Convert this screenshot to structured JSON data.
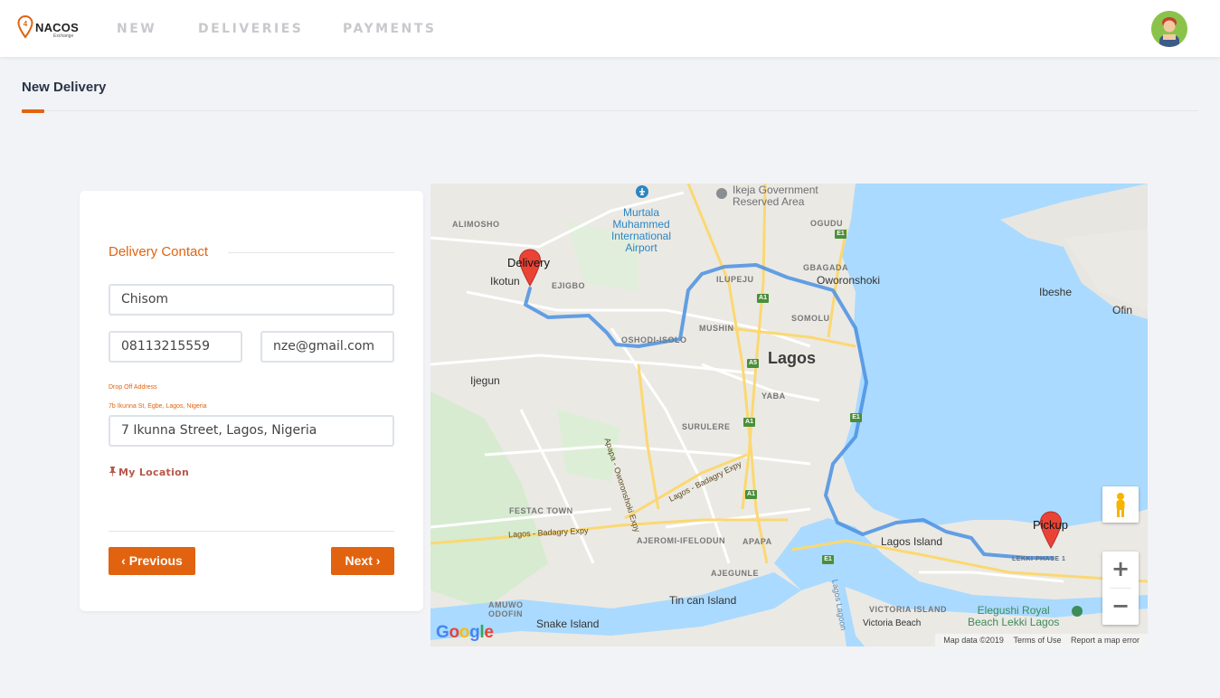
{
  "header": {
    "logo_text": "NACOS",
    "logo_sub": "Exchange",
    "nav": [
      "NEW",
      "DELIVERIES",
      "PAYMENTS"
    ]
  },
  "page": {
    "title": "New Delivery"
  },
  "form": {
    "section_title": "Delivery Contact",
    "name_value": "Chisom",
    "phone_value": "08113215559",
    "email_value": "nze@gmail.com",
    "dropoff_label": "Drop Off Address",
    "dropoff_hint": "7b Ikunna St, Egbe, Lagos, Nigeria",
    "address_value": "7 Ikunna Street, Lagos, Nigeria",
    "my_location": "My Location",
    "prev_label": "Previous",
    "next_label": "Next"
  },
  "map": {
    "markers": {
      "delivery": "Delivery",
      "pickup": "Pickup"
    },
    "labels": {
      "alimosho": "ALIMOSHO",
      "ikotun": "Ikotun",
      "ejigbo": "EJIGBO",
      "ijegun": "Ijegun",
      "airport": [
        "Murtala",
        "Muhammed",
        "International",
        "Airport"
      ],
      "reserved": [
        "Ikeja Government",
        "Reserved Area"
      ],
      "ogudu": "OGUDU",
      "gbagada": "GBAGADA",
      "oworonshoki": "Oworonshoki",
      "ilupeju": "ILUPEJU",
      "mushin": "MUSHIN",
      "somolu": "SOMOLU",
      "oshodi": "OSHODI-ISOLO",
      "lagos": "Lagos",
      "yaba": "YABA",
      "surulere": "SURULERE",
      "apapa_oworonshoki": "Apapa - Oworonshoki Expy",
      "lagos_badagry": "Lagos - Badagry Expy",
      "lagos_badagry_2": "Lagos - Badagry Expy",
      "festac": "FESTAC TOWN",
      "ajeromi": "AJEROMI-IFELODUN",
      "apapa": "APAPA",
      "ajegunle": "AJEGUNLE",
      "tincan": "Tin can Island",
      "amuwo": [
        "AMUWO",
        "ODOFIN"
      ],
      "snake": "Snake Island",
      "lagos_island": "Lagos Island",
      "victoria_island": "VICTORIA ISLAND",
      "victoria_beach": "Victoria Beach",
      "lagos_lagoon": "Lagos Lagoon",
      "lekki": "LEKKI PHASE 1",
      "elegushi": [
        "Elegushi Royal",
        "Beach Lekki Lagos"
      ],
      "ibeshe": "Ibeshe",
      "ofin": "Ofin"
    },
    "shields": [
      "E1",
      "A1",
      "A1",
      "A5",
      "A1",
      "A1",
      "E1",
      "E1"
    ],
    "zoom_in": "+",
    "zoom_out": "−",
    "google": "Google",
    "attribution": [
      "Map data ©2019",
      "Terms of Use",
      "Report a map error"
    ]
  },
  "colors": {
    "accent": "#e2630f",
    "route": "#4a90e2",
    "water": "#aadaff",
    "marker": "#ea4335"
  }
}
